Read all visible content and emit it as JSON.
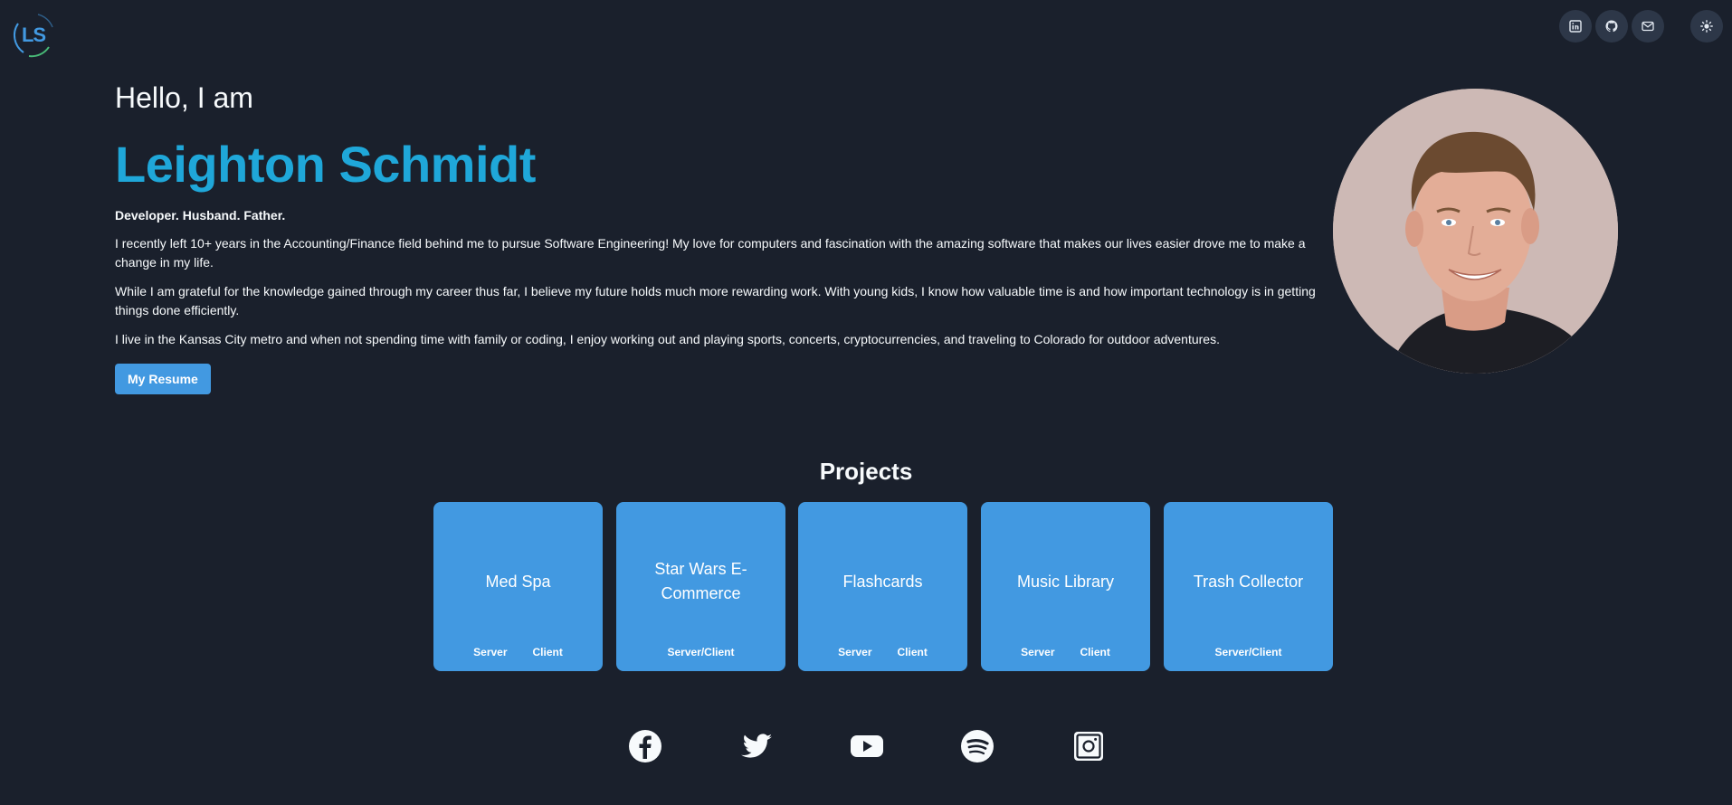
{
  "logo": {
    "text": "LS"
  },
  "header": {
    "icons": [
      "linkedin-icon",
      "github-icon",
      "mail-icon",
      "sun-icon"
    ]
  },
  "hero": {
    "greeting": "Hello, I am",
    "name": "Leighton Schmidt",
    "tagline": "Developer. Husband. Father.",
    "paragraphs": [
      "I recently left 10+ years in the Accounting/Finance field behind me to pursue Software Engineering! My love for computers and fascination with the amazing software that makes our lives easier drove me to make a change in my life.",
      "While I am grateful for the knowledge gained through my career thus far, I believe my future holds much more rewarding work. With young kids, I know how valuable time is and how important technology is in getting things done efficiently.",
      "I live in the Kansas City metro and when not spending time with family or coding, I enjoy working out and playing sports, concerts, cryptocurrencies, and traveling to Colorado for outdoor adventures."
    ],
    "resume_button": "My Resume"
  },
  "projects": {
    "title": "Projects",
    "items": [
      {
        "title": "Med Spa",
        "links": [
          "Server",
          "Client"
        ]
      },
      {
        "title": "Star Wars E-Commerce",
        "links": [
          "Server/Client"
        ]
      },
      {
        "title": "Flashcards",
        "links": [
          "Server",
          "Client"
        ]
      },
      {
        "title": "Music Library",
        "links": [
          "Server",
          "Client"
        ]
      },
      {
        "title": "Trash Collector",
        "links": [
          "Server/Client"
        ]
      }
    ]
  },
  "socials": [
    "facebook-icon",
    "twitter-icon",
    "youtube-icon",
    "spotify-icon",
    "instagram-icon"
  ],
  "colors": {
    "background": "#1a202c",
    "accent": "#4299e1",
    "name": "#1fa7d9",
    "icon_button_bg": "#2d3748"
  }
}
